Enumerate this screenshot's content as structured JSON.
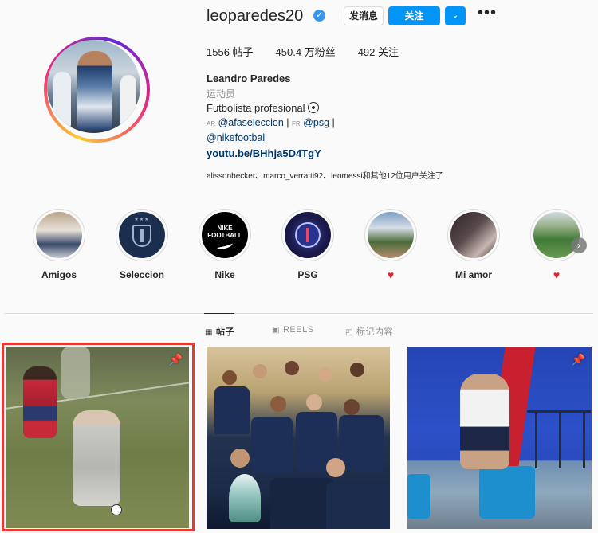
{
  "profile": {
    "username": "leoparedes20",
    "verified_glyph": "✓",
    "buttons": {
      "message": "发消息",
      "follow": "关注",
      "dropdown": "⌄",
      "more": "•••"
    },
    "stats": {
      "posts": "1556 帖子",
      "followers": "450.4 万粉丝",
      "following": "492 关注"
    },
    "full_name": "Leandro Paredes",
    "category": "运动员",
    "bio_line1": "Futbolista profesional",
    "bio_cc1": "AR",
    "bio_handle1": "@afaseleccion",
    "bio_sep1": "|",
    "bio_cc2": "FR",
    "bio_handle2": "@psg",
    "bio_sep2": "|",
    "bio_handle3": "@nikefootball",
    "link": "youtu.be/BHhja5D4TgY",
    "followed_by": "alissonbecker、marco_verratti92、leomessi和其他12位用户关注了"
  },
  "highlights": [
    {
      "label": "Amigos"
    },
    {
      "label": "Seleccion"
    },
    {
      "label": "Nike"
    },
    {
      "label": "PSG"
    },
    {
      "label": "",
      "heart": "♥"
    },
    {
      "label": "Mi amor"
    },
    {
      "label": "",
      "heart": "♥"
    }
  ],
  "nike_cover_text": "NIKE\nFOOTBALL",
  "tabs": [
    {
      "icon": "▦",
      "label": "帖子"
    },
    {
      "icon": "▣",
      "label": "REELS"
    },
    {
      "icon": "◰",
      "label": "标记内容"
    }
  ],
  "post_pin_glyph": "📌",
  "colors": {
    "accent": "#0095f6",
    "link": "#00376b",
    "highlight_border": "#e53935",
    "heart": "#ed1f34"
  }
}
